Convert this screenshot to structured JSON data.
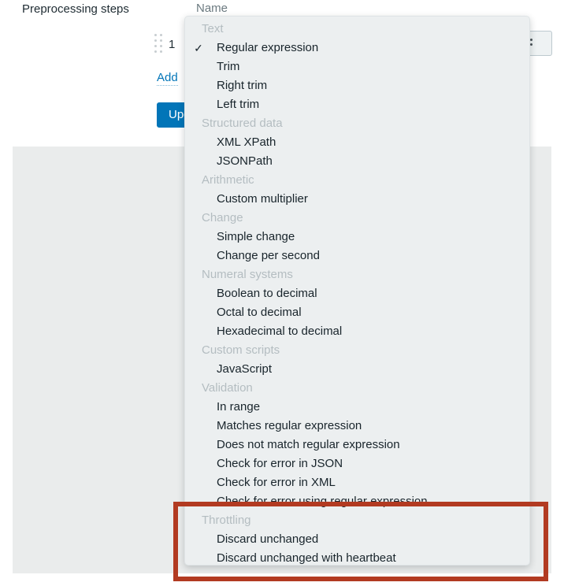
{
  "form": {
    "section_label": "Preprocessing steps",
    "column_header_name": "Name",
    "step_index": "1",
    "add_link": "Add",
    "update_button": "Update",
    "remove_button_icon": "kebab-menu-icon"
  },
  "dropdown": {
    "selected_item": "Regular expression",
    "check_glyph": "✓",
    "groups": [
      {
        "title": "Text",
        "items": [
          {
            "label": "Regular expression",
            "selected": true
          },
          {
            "label": "Trim",
            "selected": false
          },
          {
            "label": "Right trim",
            "selected": false
          },
          {
            "label": "Left trim",
            "selected": false
          }
        ]
      },
      {
        "title": "Structured data",
        "items": [
          {
            "label": "XML XPath",
            "selected": false
          },
          {
            "label": "JSONPath",
            "selected": false
          }
        ]
      },
      {
        "title": "Arithmetic",
        "items": [
          {
            "label": "Custom multiplier",
            "selected": false
          }
        ]
      },
      {
        "title": "Change",
        "items": [
          {
            "label": "Simple change",
            "selected": false
          },
          {
            "label": "Change per second",
            "selected": false
          }
        ]
      },
      {
        "title": "Numeral systems",
        "items": [
          {
            "label": "Boolean to decimal",
            "selected": false
          },
          {
            "label": "Octal to decimal",
            "selected": false
          },
          {
            "label": "Hexadecimal to decimal",
            "selected": false
          }
        ]
      },
      {
        "title": "Custom scripts",
        "items": [
          {
            "label": "JavaScript",
            "selected": false
          }
        ]
      },
      {
        "title": "Validation",
        "items": [
          {
            "label": "In range",
            "selected": false
          },
          {
            "label": "Matches regular expression",
            "selected": false
          },
          {
            "label": "Does not match regular expression",
            "selected": false
          },
          {
            "label": "Check for error in JSON",
            "selected": false
          },
          {
            "label": "Check for error in XML",
            "selected": false
          },
          {
            "label": "Check for error using regular expression",
            "selected": false
          }
        ]
      },
      {
        "title": "Throttling",
        "items": [
          {
            "label": "Discard unchanged",
            "selected": false
          },
          {
            "label": "Discard unchanged with heartbeat",
            "selected": false
          }
        ]
      }
    ]
  },
  "annotation": {
    "highlight_color": "#b23a21"
  },
  "colors": {
    "accent_blue": "#0275b8",
    "menu_background": "#eceff0",
    "panel_gray": "#eaecec",
    "group_title_gray": "#b4bdc1",
    "item_text": "#18242b"
  }
}
